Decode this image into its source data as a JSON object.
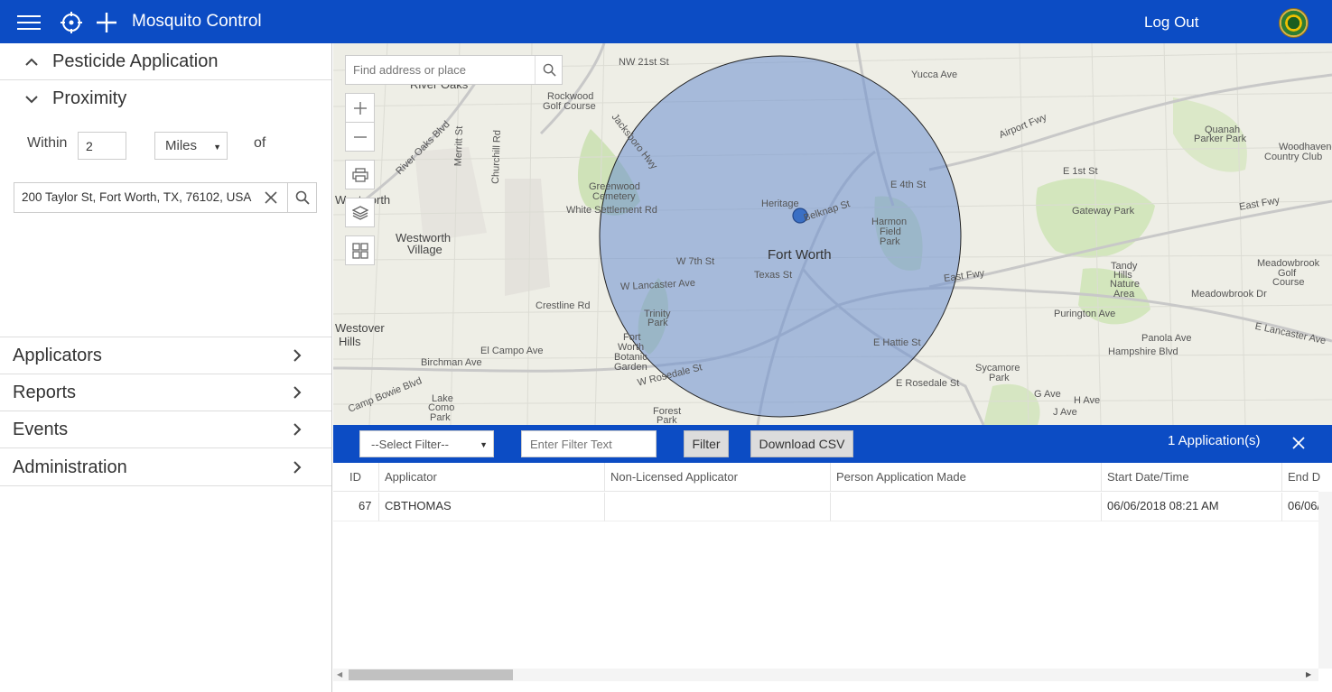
{
  "header": {
    "title": "Mosquito Control",
    "logout_label": "Log Out"
  },
  "sidebar": {
    "sections": [
      {
        "label": "Pesticide Application",
        "expanded": true
      },
      {
        "label": "Proximity",
        "expanded": true
      }
    ],
    "proximity": {
      "within_label": "Within",
      "distance_value": "2",
      "units_value": "Miles",
      "of_label": "of",
      "address_value": "200 Taylor St, Fort Worth, TX, 76102, USA"
    },
    "menu": [
      {
        "label": "Applicators"
      },
      {
        "label": "Reports"
      },
      {
        "label": "Events"
      },
      {
        "label": "Administration"
      }
    ]
  },
  "map": {
    "search_placeholder": "Find address or place",
    "labels": {
      "nw21": "NW 21st St",
      "river_oaks": "River Oaks",
      "rockwood": "Rockwood",
      "golf_course": "Golf Course",
      "yucca": "Yucca Ave",
      "quanah": "Quanah",
      "parker_park": "Parker Park",
      "woodhaven": "Woodhaven",
      "country_club": "Country Club",
      "airport_fwy": "Airport Fwy",
      "e1st": "E 1st St",
      "gateway": "Gateway Park",
      "east_fwy": "East Fwy",
      "e4th": "E 4th St",
      "harmon": "Harmon",
      "field": "Field",
      "park": "Park",
      "heritage": "Heritage",
      "greenwood": "Greenwood",
      "cemetery": "Cemetery",
      "white_settlement": "White Settlement Rd",
      "westworth": "Westworth",
      "westworth2": "Westworth",
      "village": "Village",
      "fort_worth": "Fort Worth",
      "w7th": "W 7th St",
      "texas_st": "Texas St",
      "w_lancaster": "W Lancaster Ave",
      "crestline": "Crestline Rd",
      "trinity": "Trinity",
      "tandy_hills": "Tandy",
      "hills": "Hills",
      "nature": "Nature",
      "area": "Area",
      "meadowbrook": "Meadowbrook",
      "meadowbrook_dr": "Meadowbrook Dr",
      "golf": "Golf",
      "course": "Course",
      "purington": "Purington Ave",
      "panola": "Panola Ave",
      "e_lancaster": "E Lancaster Ave",
      "hampshire": "Hampshire Blvd",
      "e_hattie": "E Hattie St",
      "e_rosedale": "E Rosedale St",
      "sycamore": "Sycamore",
      "g_ave": "G Ave",
      "h_ave": "H Ave",
      "j_ave": "J Ave",
      "westover": "Westover",
      "hills2": "Hills",
      "el_campo": "El Campo Ave",
      "birchman": "Birchman Ave",
      "camp_bowie": "Camp Bowie Blvd",
      "lake": "Lake",
      "como": "Como",
      "fort_worth_bot": "Fort",
      "worth": "Worth",
      "botanic": "Botanic",
      "garden": "Garden",
      "forest": "Forest",
      "w_rosedale": "W Rosedale St",
      "belknap": "Belknap St",
      "jacksboro": "Jacksboro Hwy",
      "river_oaks_blvd": "River Oaks Blvd",
      "merritt": "Merritt St",
      "churchill": "Churchill Rd",
      "east_fwy2": "East Fwy"
    }
  },
  "results": {
    "filter_placeholder": "--Select Filter--",
    "filter_text_placeholder": "Enter Filter Text",
    "filter_btn": "Filter",
    "download_btn": "Download CSV",
    "count_label": "1 Application(s)",
    "columns": [
      "ID",
      "Applicator",
      "Non-Licensed Applicator",
      "Person Application Made",
      "Start Date/Time",
      "End D"
    ],
    "rows": [
      {
        "id": "67",
        "applicator": "CBTHOMAS",
        "non_licensed": "",
        "person": "",
        "start": "06/06/2018 08:21 AM",
        "end": "06/06/"
      }
    ]
  },
  "colors": {
    "brand_blue": "#0c4cc4",
    "buffer_fill": "#6b8fd0"
  }
}
